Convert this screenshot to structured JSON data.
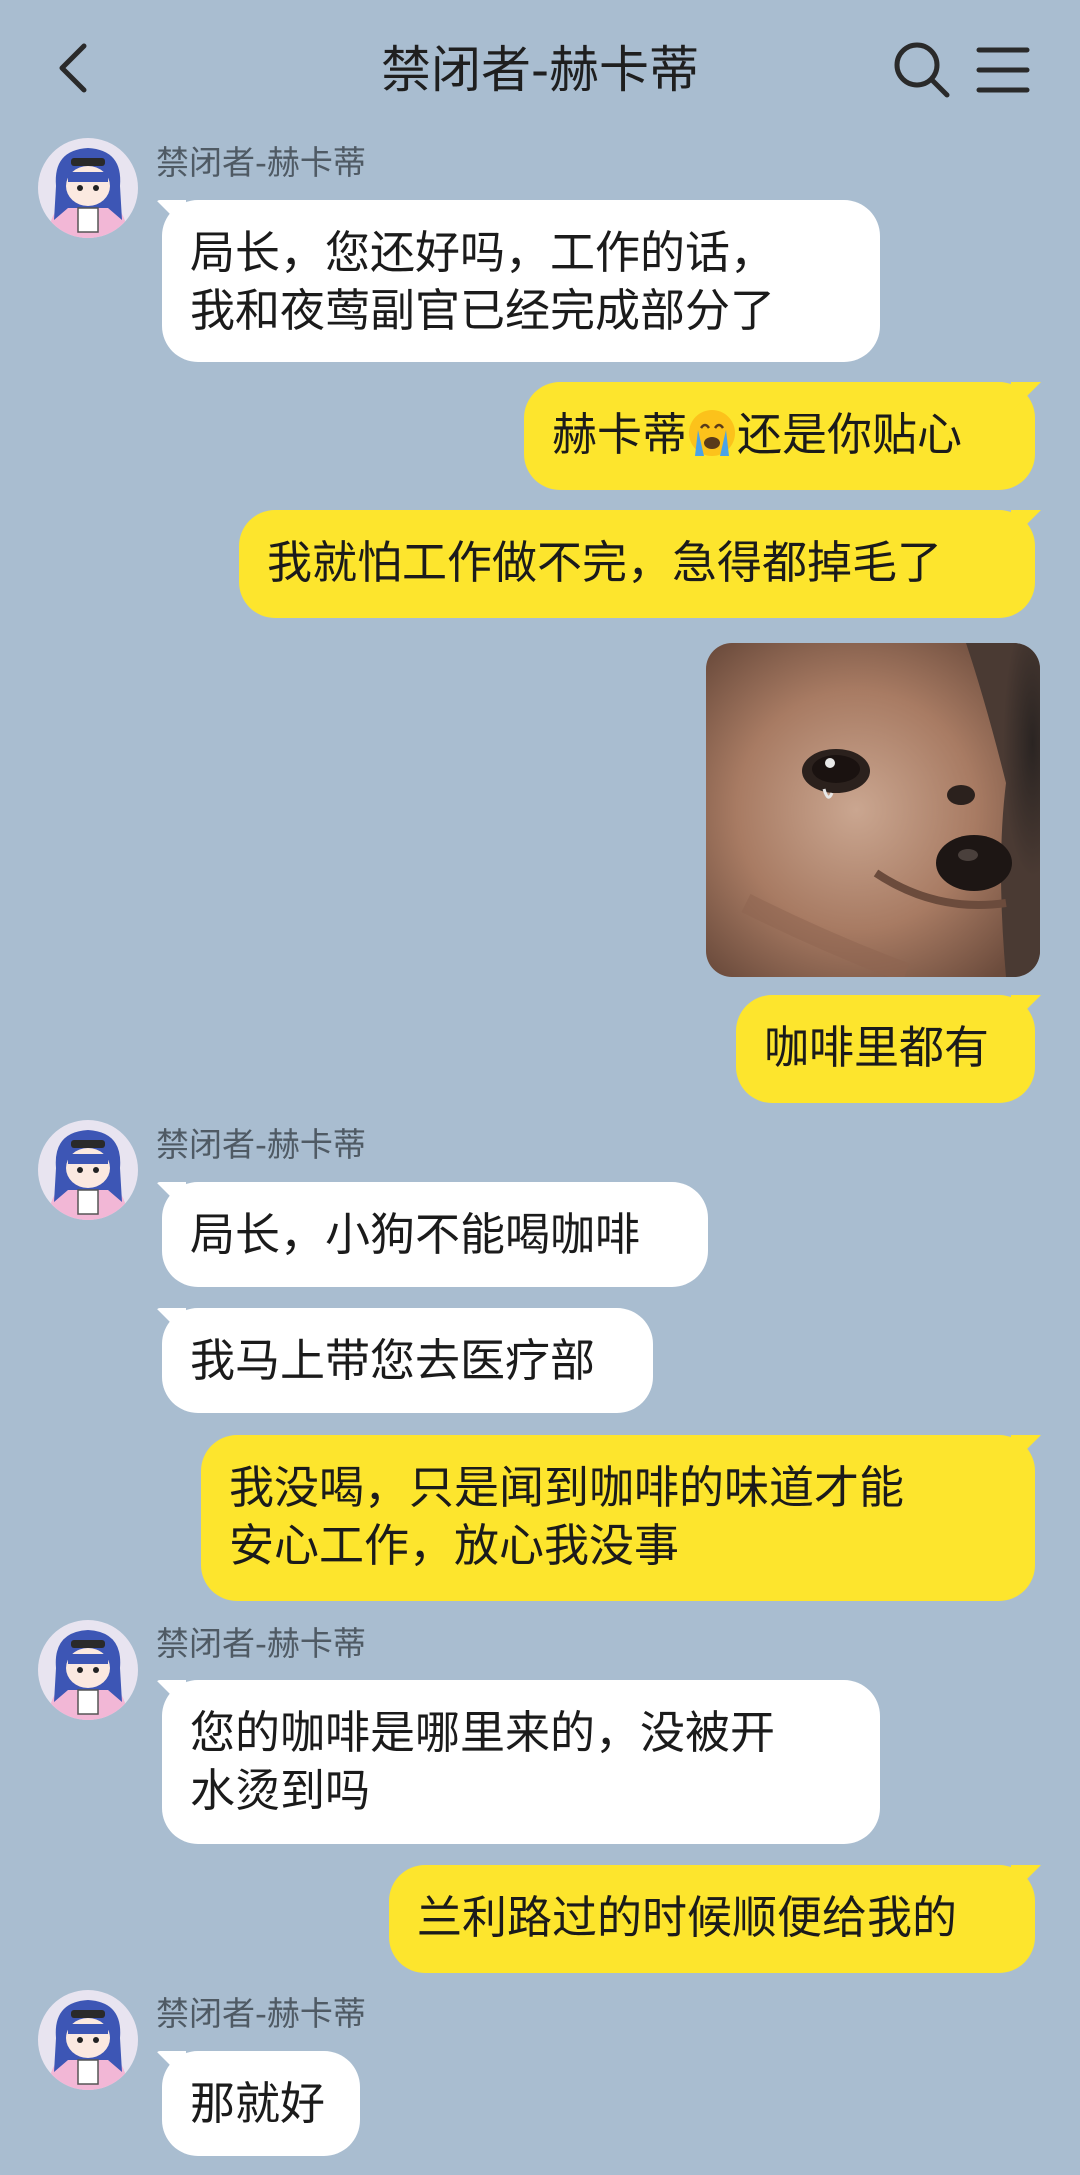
{
  "header": {
    "title": "禁闭者-赫卡蒂",
    "back_icon": "chevron-left-icon",
    "search_icon": "search-icon",
    "menu_icon": "menu-icon"
  },
  "colors": {
    "background": "#a9bdd0",
    "incoming_bubble": "#ffffff",
    "outgoing_bubble": "#fde52d",
    "sender_text": "#4f5a64"
  },
  "messages": [
    {
      "sender": "禁闭者-赫卡蒂",
      "lines": [
        "局长，您还好吗，工作的话，",
        "我和夜莺副官已经完成部分了"
      ],
      "direction": "in"
    },
    {
      "text_before": "赫卡蒂",
      "emoji": "loudly-crying-face-icon",
      "text_after": "还是你贴心",
      "direction": "out"
    },
    {
      "text": "我就怕工作做不完，急得都掉毛了",
      "direction": "out"
    },
    {
      "image": "crying-chihuahua-photo",
      "direction": "out"
    },
    {
      "text": "咖啡里都有",
      "direction": "out"
    },
    {
      "sender": "禁闭者-赫卡蒂",
      "text": "局长，小狗不能喝咖啡",
      "direction": "in"
    },
    {
      "text": "我马上带您去医疗部",
      "direction": "in"
    },
    {
      "lines": [
        "我没喝，只是闻到咖啡的味道才能",
        "安心工作，放心我没事"
      ],
      "direction": "out"
    },
    {
      "sender": "禁闭者-赫卡蒂",
      "lines": [
        "您的咖啡是哪里来的，没被开",
        "水烫到吗"
      ],
      "direction": "in"
    },
    {
      "text": "兰利路过的时候顺便给我的",
      "direction": "out"
    },
    {
      "sender": "禁闭者-赫卡蒂",
      "text": "那就好",
      "direction": "in"
    }
  ]
}
